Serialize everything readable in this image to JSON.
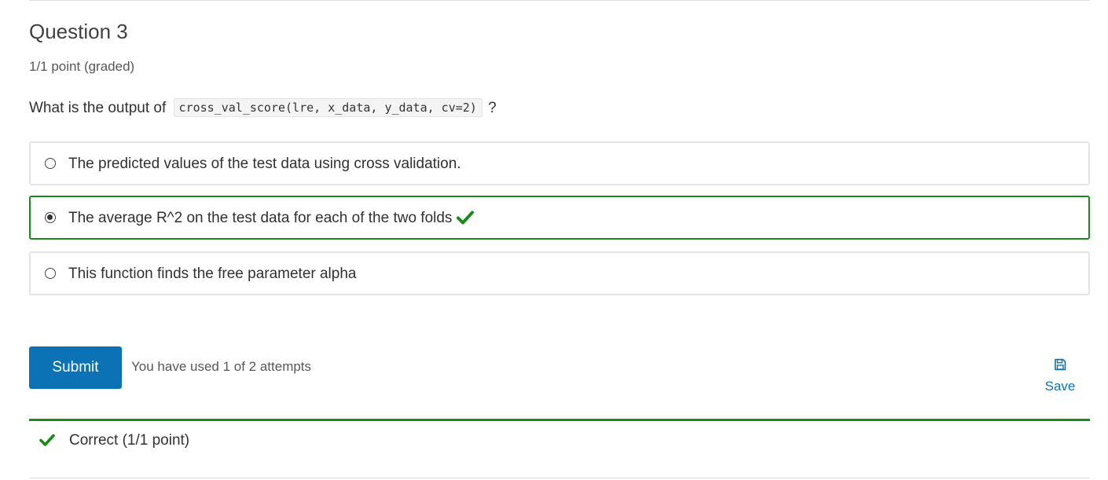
{
  "question": {
    "title": "Question 3",
    "points": "1/1 point (graded)",
    "prompt_prefix": "What is the output of",
    "prompt_code": "cross_val_score(lre, x_data, y_data, cv=2)",
    "prompt_suffix": "?"
  },
  "choices": [
    {
      "label": "The predicted values of the test data using cross validation.",
      "selected": false,
      "correct": false
    },
    {
      "label": "The average R^2 on the test data for each of the two folds",
      "selected": true,
      "correct": true
    },
    {
      "label": "This function finds the free parameter alpha",
      "selected": false,
      "correct": false
    }
  ],
  "actions": {
    "submit_label": "Submit",
    "attempts_text": "You have used 1 of 2 attempts",
    "save_label": "Save"
  },
  "result": {
    "text": "Correct (1/1 point)"
  },
  "colors": {
    "accent": "#0b72b5",
    "success": "#1a8a1a"
  },
  "icons": {
    "check": "checkmark-icon",
    "save": "floppy-disk-icon",
    "radio": "radio-button-icon"
  }
}
